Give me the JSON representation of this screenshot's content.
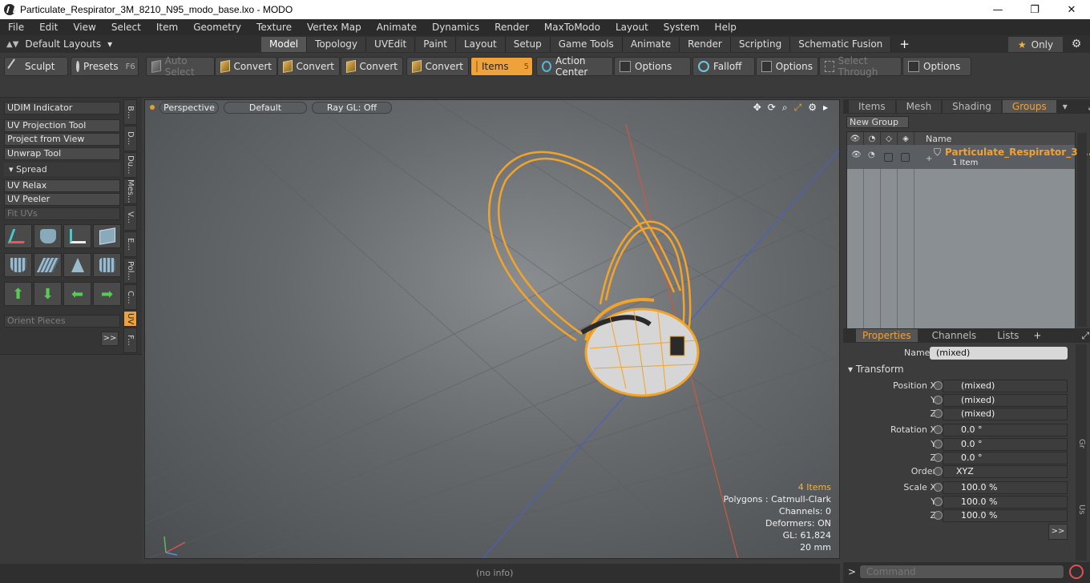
{
  "window": {
    "title": "Particulate_Respirator_3M_8210_N95_modo_base.lxo - MODO",
    "min": "—",
    "max": "❐",
    "close": "✕"
  },
  "menu": [
    "File",
    "Edit",
    "View",
    "Select",
    "Item",
    "Geometry",
    "Texture",
    "Vertex Map",
    "Animate",
    "Dynamics",
    "Render",
    "MaxToModo",
    "Layout",
    "System",
    "Help"
  ],
  "layouts": {
    "label": "Default Layouts"
  },
  "tabs": [
    "Model",
    "Topology",
    "UVEdit",
    "Paint",
    "Layout",
    "Setup",
    "Game Tools",
    "Animate",
    "Render",
    "Scripting",
    "Schematic Fusion"
  ],
  "active_tab": "Model",
  "only_label": "Only",
  "toolbar": {
    "sculpt": "Sculpt",
    "presets": "Presets",
    "presets_hotkey": "F6",
    "auto_select": "Auto Select",
    "convert1": "Convert",
    "convert2": "Convert",
    "convert3": "Convert",
    "convert4": "Convert",
    "items": "Items",
    "items_hotkey": "5",
    "action_center": "Action Center",
    "options1": "Options",
    "falloff": "Falloff",
    "options2": "Options",
    "select_through": "Select Through",
    "options3": "Options"
  },
  "left_panel": {
    "udim": "UDIM Indicator",
    "uv_projection": "UV Projection Tool",
    "project_from_view": "Project from View",
    "unwrap": "Unwrap Tool",
    "spread": "Spread",
    "uv_relax": "UV Relax",
    "uv_peeler": "UV Peeler",
    "fit_uvs": "Fit UVs",
    "orient_pieces": "Orient Pieces",
    "more": ">>",
    "vtabs": [
      "B...",
      "D...",
      "Du...",
      "Mes...",
      "V...",
      "E...",
      "Pol...",
      "C...",
      "UV",
      "F..."
    ]
  },
  "viewport": {
    "perspective": "Perspective",
    "default": "Default",
    "raygl": "Ray GL: Off",
    "stats": {
      "items": "4 Items",
      "polygons": "Polygons : Catmull-Clark",
      "channels": "Channels: 0",
      "deformers": "Deformers: ON",
      "gl": "GL: 61,824",
      "scale": "20 mm"
    }
  },
  "status": {
    "info": "(no info)"
  },
  "groups_panel": {
    "tabs": [
      "Items",
      "Mesh ...",
      "Shading",
      "Groups"
    ],
    "active_tab": "Groups",
    "new_group": "New Group",
    "name_header": "Name",
    "row": {
      "name": "Particulate_Respirator_3 ...",
      "sub": "1 Item"
    }
  },
  "properties_panel": {
    "tabs": [
      "Properties",
      "Channels",
      "Lists"
    ],
    "active_tab": "Properties",
    "name_label": "Name",
    "name_value": "(mixed)",
    "transform": "Transform",
    "rows": [
      {
        "label": "Position X",
        "value": "(mixed)"
      },
      {
        "label": "Y",
        "value": "(mixed)"
      },
      {
        "label": "Z",
        "value": "(mixed)"
      },
      {
        "label": "Rotation X",
        "value": "0.0 °"
      },
      {
        "label": "Y",
        "value": "0.0 °"
      },
      {
        "label": "Z",
        "value": "0.0 °"
      },
      {
        "label": "Order",
        "value": "XYZ"
      },
      {
        "label": "Scale X",
        "value": "100.0 %"
      },
      {
        "label": "Y",
        "value": "100.0 %"
      },
      {
        "label": "Z",
        "value": "100.0 %"
      }
    ],
    "more": ">>",
    "side_tabs": [
      "Gr",
      "Us"
    ]
  },
  "command": {
    "placeholder": "Command"
  },
  "colors": {
    "accent": "#f0a23a",
    "selection_mesh": "#f5a623"
  }
}
